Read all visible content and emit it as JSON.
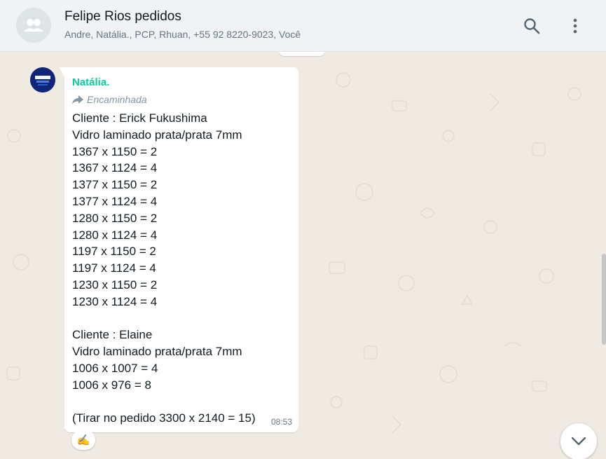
{
  "header": {
    "title": "Felipe Rios pedidos",
    "participants": "Andre, Natália., PCP, Rhuan, +55 92 8220-9023, Você",
    "icons": {
      "avatar": "group-icon",
      "search": "search-icon",
      "menu": "menu-dots-icon"
    }
  },
  "message": {
    "sender": "Natália.",
    "forwarded_label": "Encaminhada",
    "lines": "Cliente : Erick Fukushima\nVidro laminado prata/prata 7mm\n1367 x 1150 = 2\n1367 x 1124 = 4\n1377 x 1150 = 2\n1377 x 1124 = 4\n1280 x 1150 = 2\n1280 x 1124 = 4\n1197 x 1150 = 2\n1197 x 1124 = 4\n1230 x 1150 = 2\n1230 x 1124 = 4\n\nCliente : Elaine\nVidro laminado prata/prata 7mm\n1006 x 1007 = 4\n1006 x 976 = 8\n\n(Tirar no pedido 3300 x 2140 = 15)",
    "time": "08:53",
    "reaction": "✍",
    "sender_color": "#06cf9c"
  },
  "colors": {
    "chat_bg": "#efeae2",
    "header_bg": "#f0f2f5",
    "bubble_bg": "#ffffff"
  }
}
